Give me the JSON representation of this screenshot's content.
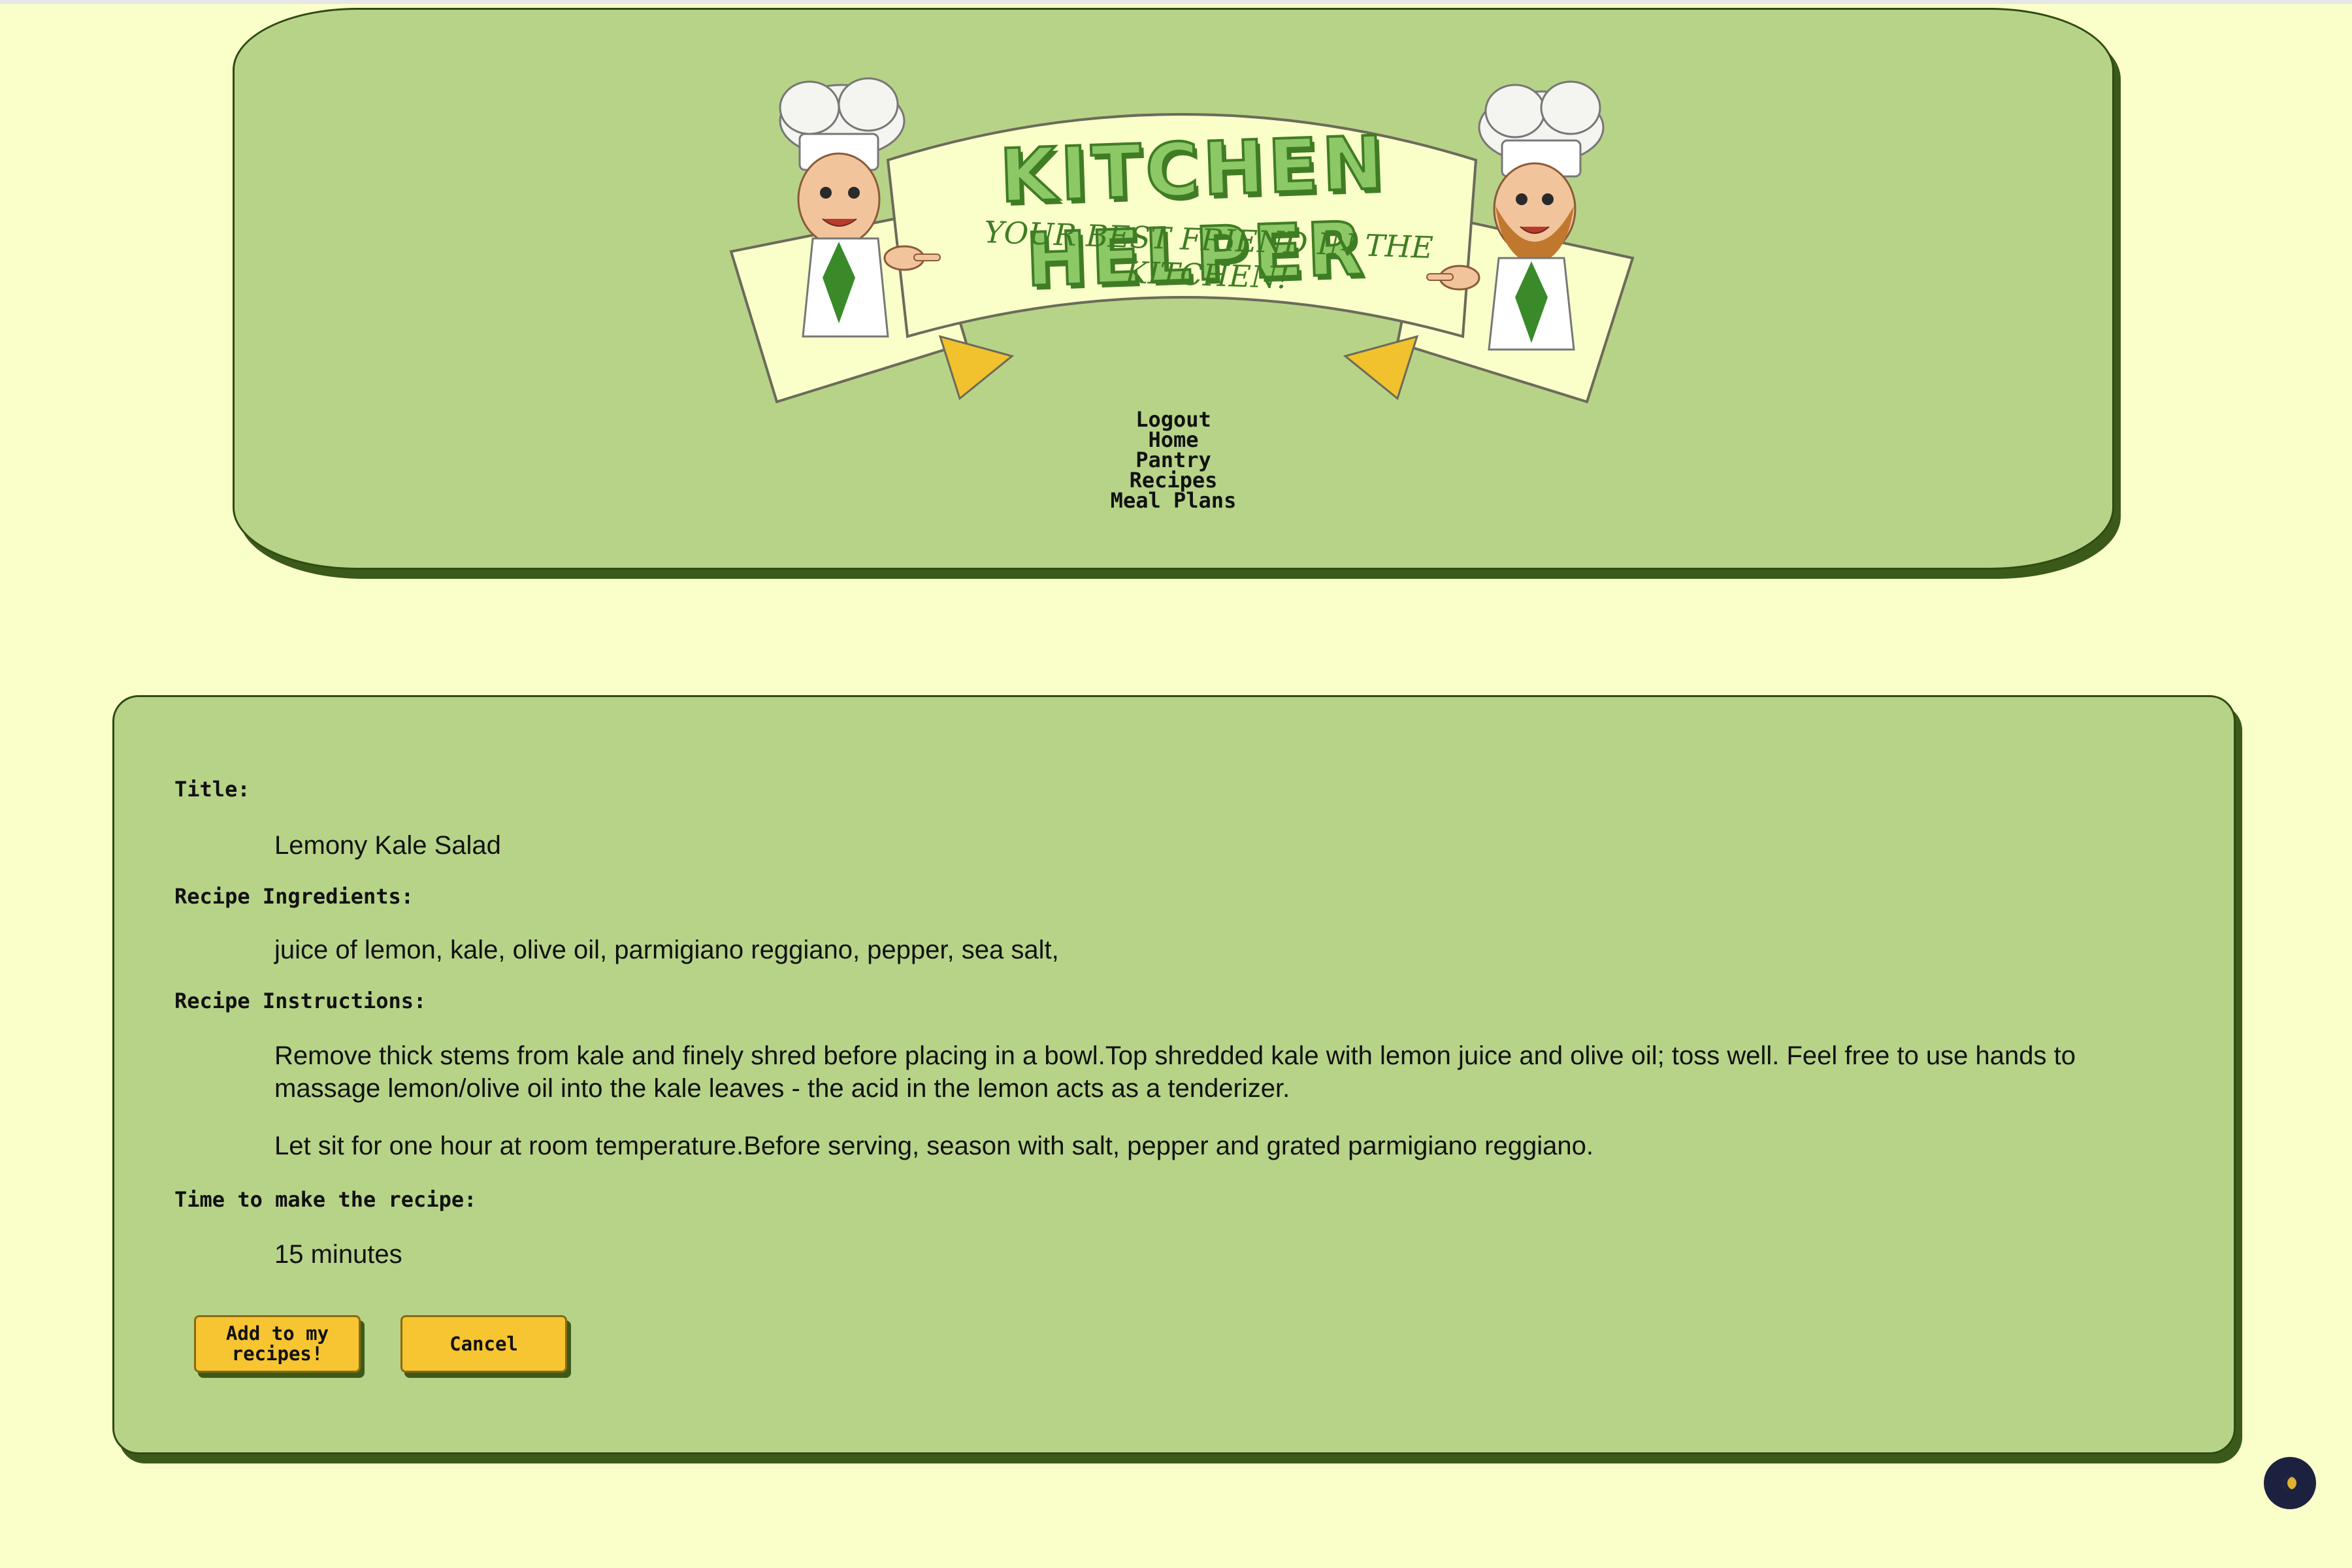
{
  "logo": {
    "title": "KITCHEN HELPER",
    "tagline": "YOUR BEST FRIEND IN THE KITCHEN!"
  },
  "nav": {
    "items": [
      "Logout",
      "Home",
      "Pantry",
      "Recipes",
      "Meal Plans"
    ]
  },
  "recipe": {
    "title_label": "Title:",
    "title_value": "Lemony Kale Salad",
    "ingredients_label": "Recipe Ingredients:",
    "ingredients_value": "juice of lemon, kale, olive oil, parmigiano reggiano, pepper, sea salt,",
    "instructions_label": "Recipe Instructions:",
    "instructions_p1": "Remove thick stems from kale and finely shred before placing in a bowl.Top shredded kale with lemon juice and olive oil; toss well. Feel free to use hands to massage lemon/olive oil into the kale leaves - the acid in the lemon acts as a tenderizer.",
    "instructions_p2": "Let sit for one hour at room temperature.Before serving, season with salt, pepper and grated parmigiano reggiano.",
    "time_label": "Time to make the recipe:",
    "time_value": "15 minutes"
  },
  "buttons": {
    "add_label": "Add to my recipes!",
    "cancel_label": "Cancel"
  },
  "floating_button": {
    "icon": "moon-icon"
  },
  "colors": {
    "page_background": "#fafec9",
    "panel_green": "#b7d388",
    "panel_shadow": "#3b5a1a",
    "button_yellow": "#f7c531",
    "logo_green": "#8cc865",
    "floating_button": "#1d2140"
  }
}
